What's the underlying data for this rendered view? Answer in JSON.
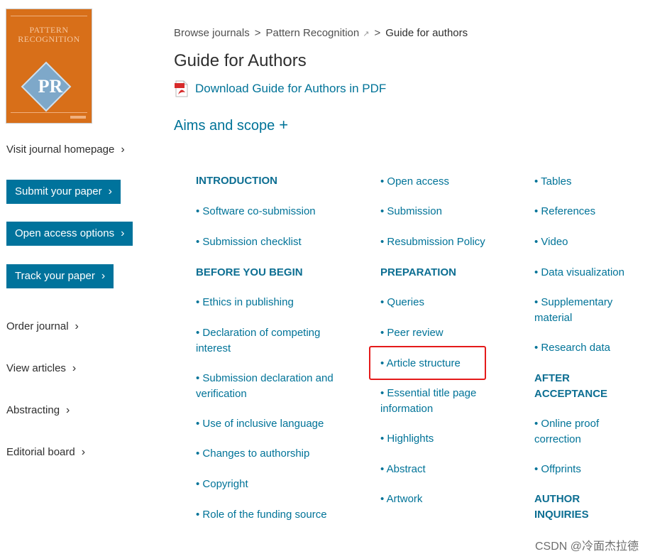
{
  "cover": {
    "title_line1": "PATTERN",
    "title_line2": "RECOGNITION",
    "monogram": "PR"
  },
  "sidebar": {
    "visit_homepage": "Visit journal homepage",
    "submit_paper": "Submit your paper",
    "open_access": "Open access options",
    "track_paper": "Track your paper",
    "order_journal": "Order journal",
    "view_articles": "View articles",
    "abstracting": "Abstracting",
    "editorial_board": "Editorial board"
  },
  "breadcrumb": {
    "browse": "Browse journals",
    "journal": "Pattern Recognition",
    "current": "Guide for authors",
    "separator": ">"
  },
  "page_title": "Guide for Authors",
  "pdf_link": "Download Guide for Authors in PDF",
  "aims": "Aims and scope",
  "aims_plus": "+",
  "toc": {
    "col1": {
      "h_intro": "INTRODUCTION",
      "software": "• Software co-submission",
      "checklist": "• Submission checklist",
      "h_before": "BEFORE YOU BEGIN",
      "ethics": "• Ethics in publishing",
      "competing": "• Declaration of competing interest",
      "declaration": "• Submission declaration and verification",
      "inclusive": "• Use of inclusive language",
      "authorship": "• Changes to authorship",
      "copyright": "• Copyright",
      "funding": "• Role of the funding source"
    },
    "col2": {
      "open_access": "• Open access",
      "submission": "• Submission",
      "resubmission": "• Resubmission Policy",
      "h_prep": "PREPARATION",
      "queries": "• Queries",
      "peer_review": "• Peer review",
      "article_structure": "• Article structure",
      "title_page": "• Essential title page information",
      "highlights": "• Highlights",
      "abstract": "• Abstract",
      "artwork": "• Artwork"
    },
    "col3": {
      "tables": "• Tables",
      "references": "• References",
      "video": "• Video",
      "data_viz": "• Data visualization",
      "supplementary": "• Supplementary material",
      "research_data": "• Research data",
      "h_after": "AFTER ACCEPTANCE",
      "proof": "• Online proof correction",
      "offprints": "• Offprints",
      "h_inquiries": "AUTHOR INQUIRIES"
    }
  },
  "watermark": "CSDN @冷面杰拉德",
  "colors": {
    "accent": "#00739c",
    "link": "#007398",
    "highlight": "#e41a1a",
    "cover": "#d86f19"
  }
}
